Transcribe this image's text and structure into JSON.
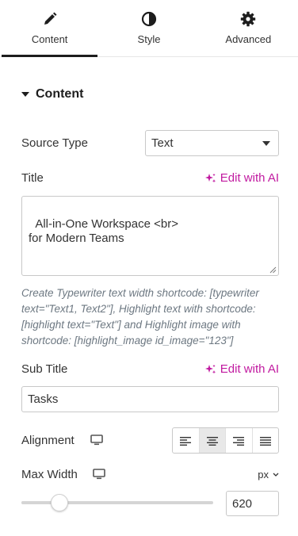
{
  "tabs": [
    {
      "label": "Content",
      "icon": "pencil-icon",
      "active": true
    },
    {
      "label": "Style",
      "icon": "contrast-icon",
      "active": false
    },
    {
      "label": "Advanced",
      "icon": "gear-icon",
      "active": false
    }
  ],
  "section": {
    "title": "Content"
  },
  "source_type": {
    "label": "Source Type",
    "value": "Text"
  },
  "title_field": {
    "label": "Title",
    "ai_link": "Edit with AI",
    "value": "All-in-One Workspace <br>\nfor Modern Teams",
    "description": "Create Typewriter text width shortcode: [typewriter text=\"Text1, Text2\"], Highlight text with shortcode: [highlight text=\"Text\"] and Highlight image with shortcode: [highlight_image id_image=\"123\"]"
  },
  "sub_title": {
    "label": "Sub Title",
    "ai_link": "Edit with AI",
    "value": "Tasks"
  },
  "alignment": {
    "label": "Alignment",
    "options": [
      "left",
      "center",
      "right",
      "justify"
    ],
    "selected": "center"
  },
  "max_width": {
    "label": "Max Width",
    "unit": "px",
    "value": "620",
    "slider_fraction": 0.2
  },
  "colors": {
    "accent_ai": "#c11aa0",
    "text": "#333333"
  }
}
